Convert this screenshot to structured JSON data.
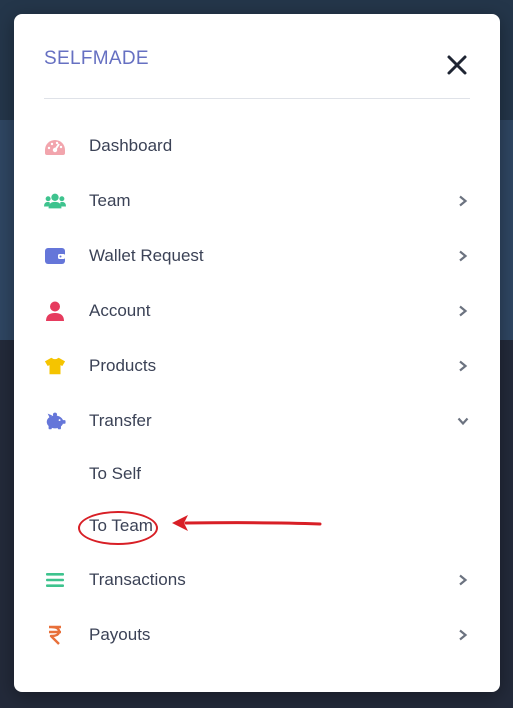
{
  "brand": "SELFMADE",
  "menu": [
    {
      "key": "dashboard",
      "label": "Dashboard",
      "icon": "speedometer-icon",
      "color": "#f2a5ad",
      "chevron": false
    },
    {
      "key": "team",
      "label": "Team",
      "icon": "users-icon",
      "color": "#3ec38e",
      "chevron": "right"
    },
    {
      "key": "wallet-request",
      "label": "Wallet Request",
      "icon": "wallet-icon",
      "color": "#6576d9",
      "chevron": "right"
    },
    {
      "key": "account",
      "label": "Account",
      "icon": "user-icon",
      "color": "#e63b5e",
      "chevron": "right"
    },
    {
      "key": "products",
      "label": "Products",
      "icon": "tshirt-icon",
      "color": "#f5c400",
      "chevron": "right"
    },
    {
      "key": "transfer",
      "label": "Transfer",
      "icon": "piggy-bank-icon",
      "color": "#6576d9",
      "chevron": "down"
    },
    {
      "key": "transactions",
      "label": "Transactions",
      "icon": "list-icon",
      "color": "#3ec38e",
      "chevron": "right"
    },
    {
      "key": "payouts",
      "label": "Payouts",
      "icon": "rupee-icon",
      "color": "#e8703a",
      "chevron": "right"
    }
  ],
  "transfer_submenu": [
    {
      "label": "To Self"
    },
    {
      "label": "To Team",
      "highlighted": true
    }
  ],
  "colors": {
    "brand": "#6670c2",
    "text": "#3b4256",
    "chevron": "#6c7380",
    "annotation": "#d81f26"
  }
}
